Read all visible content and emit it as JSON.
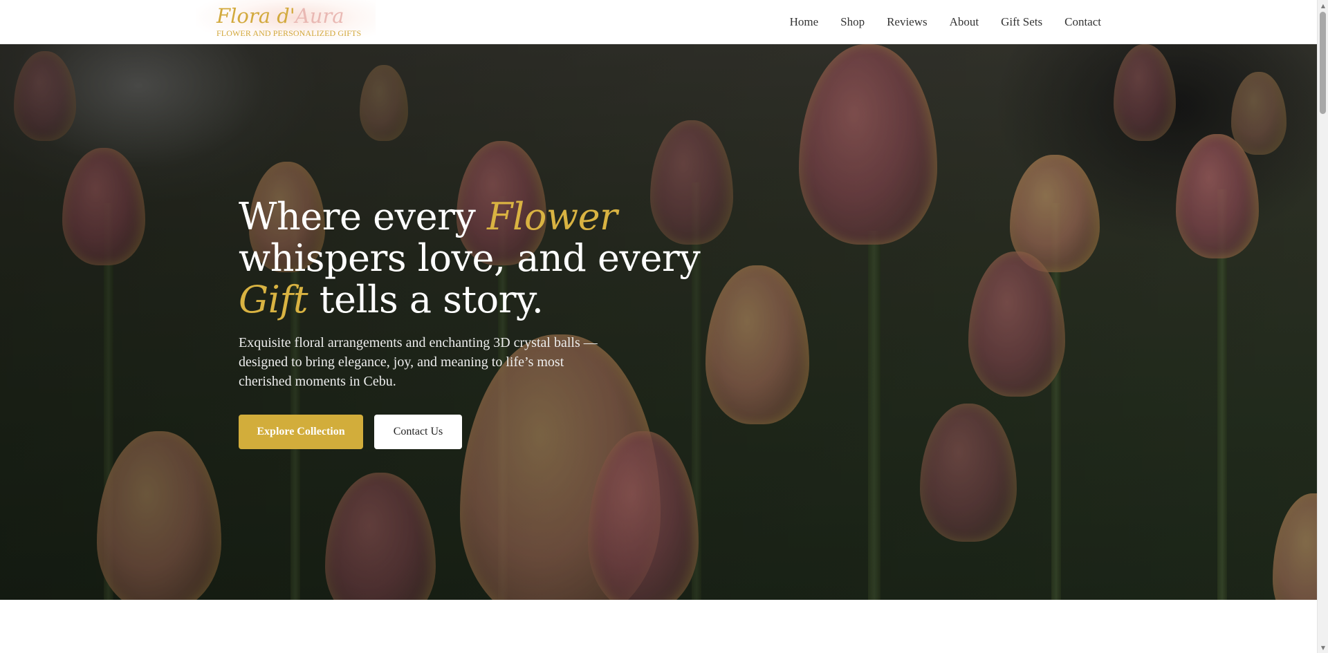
{
  "brand": {
    "name_part1": "Flora d'",
    "name_part2": "Aura",
    "tagline": "FLOWER AND PERSONALIZED GIFTS"
  },
  "nav": {
    "items": [
      {
        "label": "Home"
      },
      {
        "label": "Shop"
      },
      {
        "label": "Reviews"
      },
      {
        "label": "About"
      },
      {
        "label": "Gift Sets"
      },
      {
        "label": "Contact"
      }
    ]
  },
  "hero": {
    "heading_1": "Where every ",
    "heading_accent_1": "Flower",
    "heading_2": "whispers love, and every",
    "heading_accent_2": "Gift",
    "heading_3": " tells a story.",
    "subheading": "Exquisite floral arrangements and enchanting 3D crystal balls — designed to bring elegance, joy, and meaning to life’s most cherished moments in Cebu.",
    "primary_button": "Explore Collection",
    "secondary_button": "Contact Us"
  },
  "scrollbar": {
    "up_icon": "▲",
    "down_icon": "▼"
  },
  "colors": {
    "accent_gold": "#d2ad3b",
    "logo_pink": "#e9b8b3",
    "nav_text": "#333333"
  }
}
